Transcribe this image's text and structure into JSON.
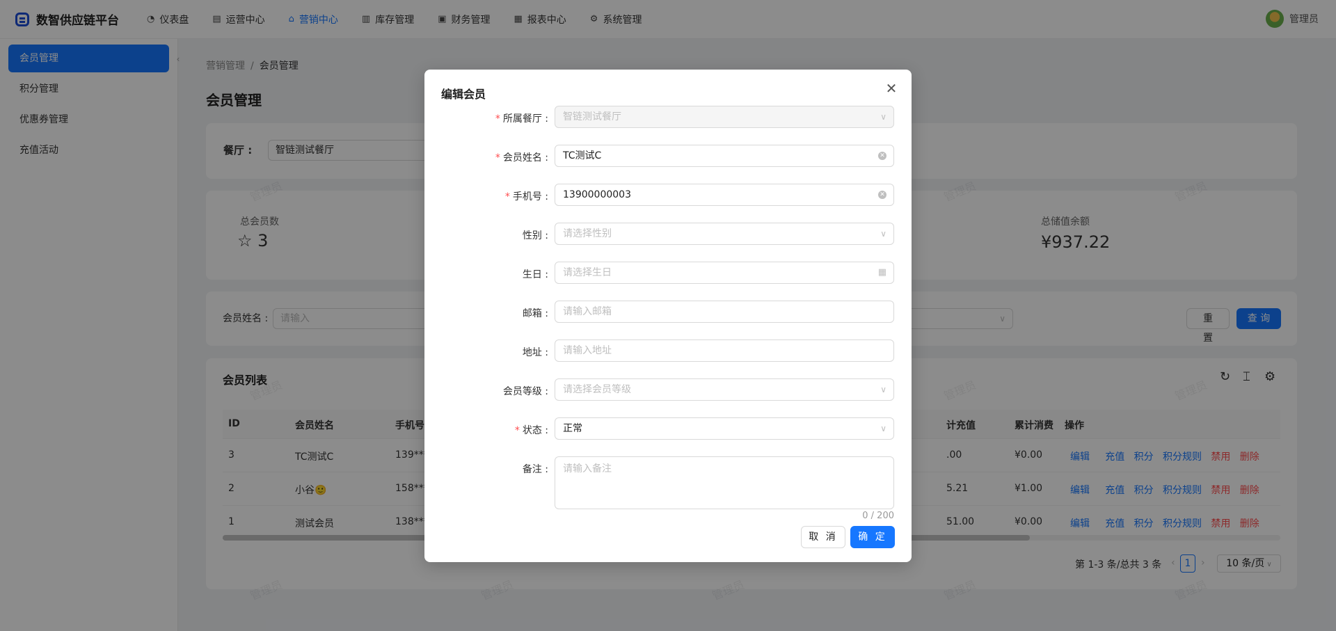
{
  "app": {
    "title": "数智供应链平台"
  },
  "nav": [
    {
      "label": "仪表盘",
      "icon": "dashboard-icon"
    },
    {
      "label": "运营中心",
      "icon": "operations-icon"
    },
    {
      "label": "营销中心",
      "icon": "gift-icon",
      "active": true
    },
    {
      "label": "库存管理",
      "icon": "inventory-icon"
    },
    {
      "label": "财务管理",
      "icon": "finance-icon"
    },
    {
      "label": "报表中心",
      "icon": "chart-icon"
    },
    {
      "label": "系统管理",
      "icon": "gear-icon"
    }
  ],
  "user": {
    "name": "管理员"
  },
  "sidebar": {
    "items": [
      "会员管理",
      "积分管理",
      "优惠券管理",
      "充值活动"
    ]
  },
  "breadcrumb": {
    "parent": "营销管理",
    "sep": "/",
    "current": "会员管理"
  },
  "page": {
    "title": "会员管理"
  },
  "filter": {
    "restaurant_label": "餐厅 :",
    "restaurant_value": "智链测试餐厅"
  },
  "stats": {
    "total_label": "总会员数",
    "total_value": "3",
    "total_icon": "star-icon",
    "balance_label": "总储值余额",
    "balance_value": "¥937.22"
  },
  "search": {
    "name_label": "会员姓名 :",
    "name_placeholder": "请输入",
    "reset": "重 置",
    "query": "查 询"
  },
  "table": {
    "title": "会员列表",
    "columns": [
      "ID",
      "会员姓名",
      "手机号",
      "计充值",
      "累计消费",
      "操作"
    ],
    "rows": [
      {
        "id": "3",
        "name": "TC测试C",
        "phone": "139***",
        "recharge": ".00",
        "spend": "¥0.00"
      },
      {
        "id": "2",
        "name": "小谷🙂",
        "phone": "158***",
        "recharge": "5.21",
        "spend": "¥1.00"
      },
      {
        "id": "1",
        "name": "测试会员",
        "phone": "138***",
        "recharge": "51.00",
        "spend": "¥0.00"
      }
    ],
    "actions": [
      "编辑",
      "充值",
      "积分",
      "积分规则",
      "禁用",
      "删除"
    ],
    "pagination": {
      "summary": "第 1-3 条/总共 3 条",
      "page": "1",
      "page_size": "10 条/页"
    }
  },
  "watermark": "管理员",
  "modal": {
    "title": "编辑会员",
    "fields": {
      "restaurant": {
        "label": "所属餐厅 :",
        "value": "智链测试餐厅"
      },
      "name": {
        "label": "会员姓名 :",
        "value": "TC测试C"
      },
      "phone": {
        "label": "手机号 :",
        "value": "13900000003"
      },
      "gender": {
        "label": "性别 :",
        "placeholder": "请选择性别"
      },
      "birthday": {
        "label": "生日 :",
        "placeholder": "请选择生日"
      },
      "email": {
        "label": "邮箱 :",
        "placeholder": "请输入邮箱"
      },
      "address": {
        "label": "地址 :",
        "placeholder": "请输入地址"
      },
      "level": {
        "label": "会员等级 :",
        "placeholder": "请选择会员等级"
      },
      "status": {
        "label": "状态 :",
        "value": "正常"
      },
      "remark": {
        "label": "备注 :",
        "placeholder": "请输入备注",
        "counter": "0 / 200"
      }
    },
    "cancel": "取 消",
    "confirm": "确 定"
  }
}
